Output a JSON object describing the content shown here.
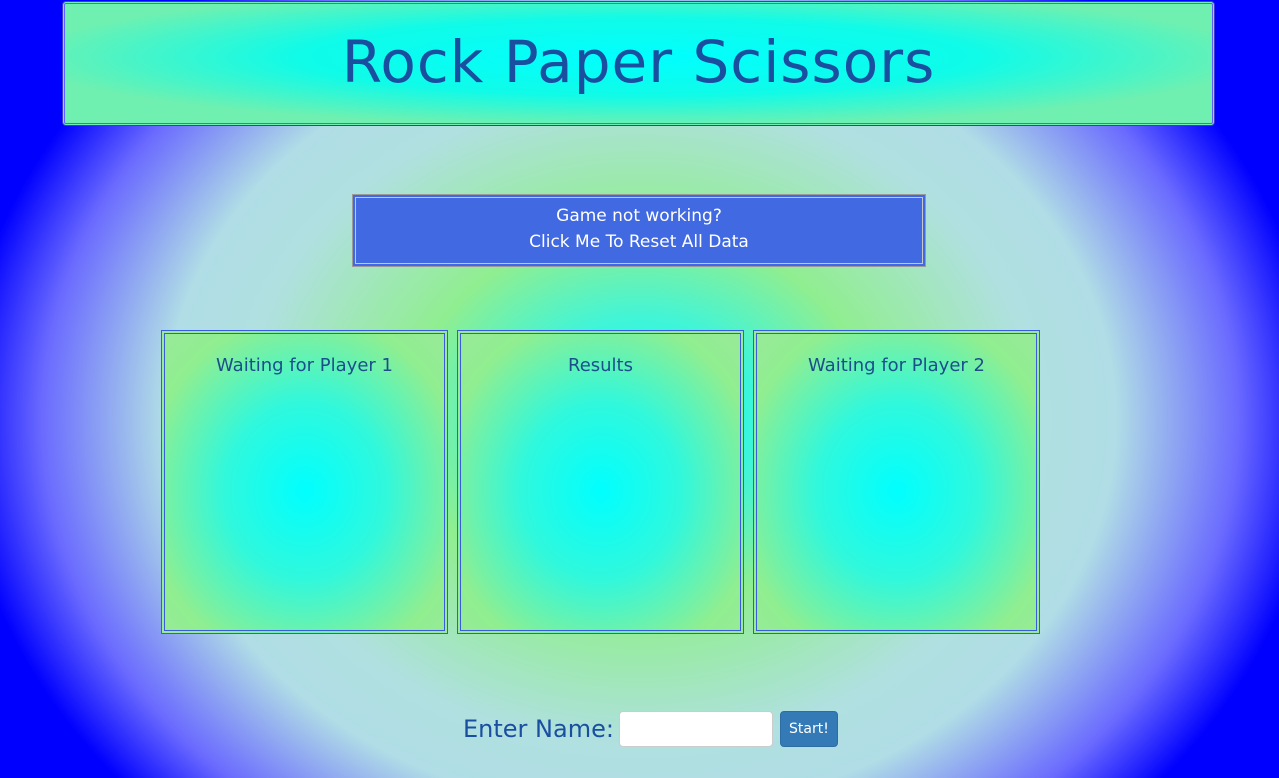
{
  "header": {
    "title": "Rock Paper Scissors"
  },
  "reset": {
    "line1": "Game not working?",
    "line2": "Click Me To Reset All Data"
  },
  "panels": [
    {
      "title": "Waiting for Player 1"
    },
    {
      "title": "Results"
    },
    {
      "title": "Waiting for Player 2"
    }
  ],
  "name_form": {
    "label": "Enter Name:",
    "value": "",
    "placeholder": "",
    "start_label": "Start!"
  },
  "colors": {
    "accent_blue": "#4169e1",
    "title_text": "#1a4fa0",
    "start_button": "#337ab7",
    "cyan": "#00ffff",
    "light_green": "#90ee90",
    "edge_blue": "#0000ff"
  }
}
